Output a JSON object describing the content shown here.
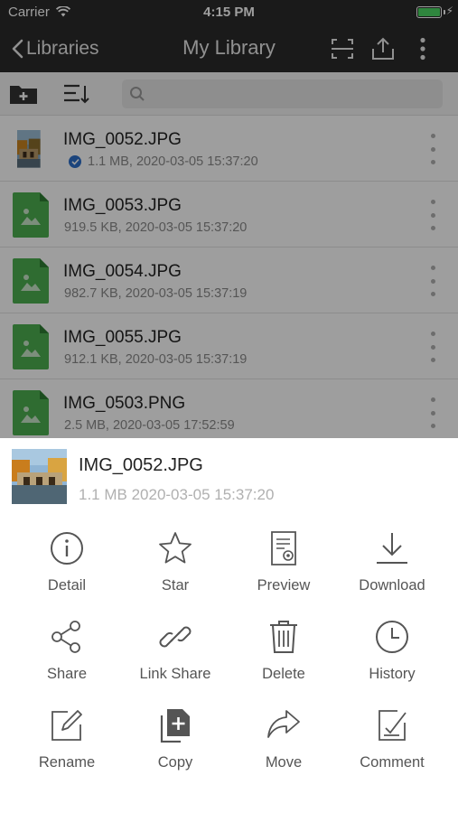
{
  "status_bar": {
    "carrier": "Carrier",
    "time": "4:15 PM"
  },
  "nav": {
    "back_label": "Libraries",
    "title": "My Library"
  },
  "search": {
    "placeholder": ""
  },
  "files": [
    {
      "name": "IMG_0052.JPG",
      "meta": "1.1 MB, 2020-03-05 15:37:20",
      "thumb": "photo",
      "starred_check": true
    },
    {
      "name": "IMG_0053.JPG",
      "meta": "919.5 KB, 2020-03-05 15:37:20",
      "thumb": "image-file-icon",
      "starred_check": false
    },
    {
      "name": "IMG_0054.JPG",
      "meta": "982.7 KB, 2020-03-05 15:37:19",
      "thumb": "image-file-icon",
      "starred_check": false
    },
    {
      "name": "IMG_0055.JPG",
      "meta": "912.1 KB, 2020-03-05 15:37:19",
      "thumb": "image-file-icon",
      "starred_check": false
    },
    {
      "name": "IMG_0503.PNG",
      "meta": "2.5 MB, 2020-03-05 17:52:59",
      "thumb": "image-file-icon",
      "starred_check": false
    }
  ],
  "sheet": {
    "file_name": "IMG_0052.JPG",
    "file_meta": "1.1 MB 2020-03-05 15:37:20",
    "actions": [
      {
        "label": "Detail",
        "icon": "info-icon"
      },
      {
        "label": "Star",
        "icon": "star-icon"
      },
      {
        "label": "Preview",
        "icon": "preview-icon"
      },
      {
        "label": "Download",
        "icon": "download-icon"
      },
      {
        "label": "Share",
        "icon": "share-icon"
      },
      {
        "label": "Link Share",
        "icon": "link-icon"
      },
      {
        "label": "Delete",
        "icon": "trash-icon"
      },
      {
        "label": "History",
        "icon": "history-icon"
      },
      {
        "label": "Rename",
        "icon": "rename-icon"
      },
      {
        "label": "Copy",
        "icon": "copy-icon"
      },
      {
        "label": "Move",
        "icon": "move-icon"
      },
      {
        "label": "Comment",
        "icon": "comment-icon"
      }
    ]
  },
  "colors": {
    "nav_background": "#2a2a2a",
    "file_icon_green": "#4caf50",
    "check_blue": "#2d6fc9",
    "action_icon": "#555555"
  }
}
